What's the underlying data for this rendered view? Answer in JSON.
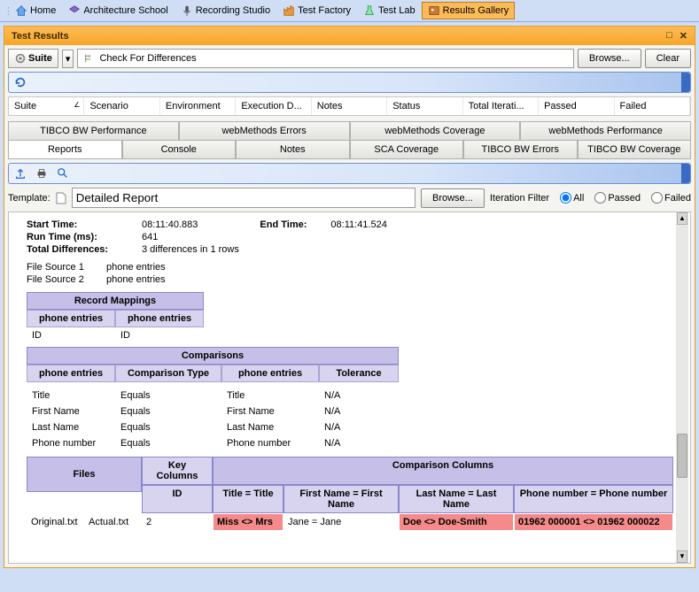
{
  "topTabs": {
    "home": "Home",
    "arch": "Architecture School",
    "rec": "Recording Studio",
    "factory": "Test Factory",
    "lab": "Test Lab",
    "gallery": "Results Gallery"
  },
  "panel": {
    "title": "Test Results"
  },
  "toolbar": {
    "suite_label": "Suite",
    "search_text": "Check For Differences",
    "browse": "Browse...",
    "clear": "Clear"
  },
  "gridCols": {
    "c0": "Suite",
    "c1": "Scenario",
    "c2": "Environment",
    "c3": "Execution D...",
    "c4": "Notes",
    "c5": "Status",
    "c6": "Total Iterati...",
    "c7": "Passed",
    "c8": "Failed"
  },
  "tabs1": {
    "t0": "TIBCO BW Performance",
    "t1": "webMethods Errors",
    "t2": "webMethods Coverage",
    "t3": "webMethods Performance"
  },
  "tabs2": {
    "t0": "Reports",
    "t1": "Console",
    "t2": "Notes",
    "t3": "SCA Coverage",
    "t4": "TIBCO BW Errors",
    "t5": "TIBCO BW Coverage"
  },
  "template": {
    "label": "Template:",
    "value": "Detailed Report",
    "browse": "Browse...",
    "iterFilter": "Iteration Filter",
    "all": "All",
    "passed": "Passed",
    "failed": "Failed"
  },
  "report": {
    "startTimeLabel": "Start Time:",
    "startTime": "08:11:40.883",
    "endTimeLabel": "End Time:",
    "endTime": "08:11:41.524",
    "runTimeLabel": "Run Time (ms):",
    "runTime": "641",
    "totalDiffLabel": "Total Differences:",
    "totalDiff": "3 differences in 1 rows",
    "fs1l": "File Source 1",
    "fs1v": "phone entries",
    "fs2l": "File Source 2",
    "fs2v": "phone entries",
    "recMapHdr": "Record Mappings",
    "pe1": "phone entries",
    "pe2": "phone entries",
    "id1": "ID",
    "id2": "ID",
    "cmpHdr": "Comparisons",
    "cmpCols": {
      "c0": "phone entries",
      "c1": "Comparison Type",
      "c2": "phone entries",
      "c3": "Tolerance"
    },
    "cmpRows": [
      {
        "a": "Title",
        "b": "Equals",
        "c": "Title",
        "d": "N/A"
      },
      {
        "a": "First Name",
        "b": "Equals",
        "c": "First Name",
        "d": "N/A"
      },
      {
        "a": "Last Name",
        "b": "Equals",
        "c": "Last Name",
        "d": "N/A"
      },
      {
        "a": "Phone number",
        "b": "Equals",
        "c": "Phone number",
        "d": "N/A"
      }
    ],
    "filesHdr": "Files",
    "keyColsHdr": "Key Columns",
    "cmpColsHdr": "Comparison Columns",
    "idHdr": "ID",
    "titleEq": "Title = Title",
    "fnEq": "First Name = First Name",
    "lnEq": "Last Name = Last Name",
    "pnEq": "Phone number = Phone number",
    "orig": "Original.txt",
    "actual": "Actual.txt",
    "rownum": "2",
    "titleDiff": "Miss <> Mrs",
    "fnSame": "Jane = Jane",
    "lnDiff": "Doe <> Doe-Smith",
    "pnDiff": "01962 000001 <> 01962 000022"
  }
}
